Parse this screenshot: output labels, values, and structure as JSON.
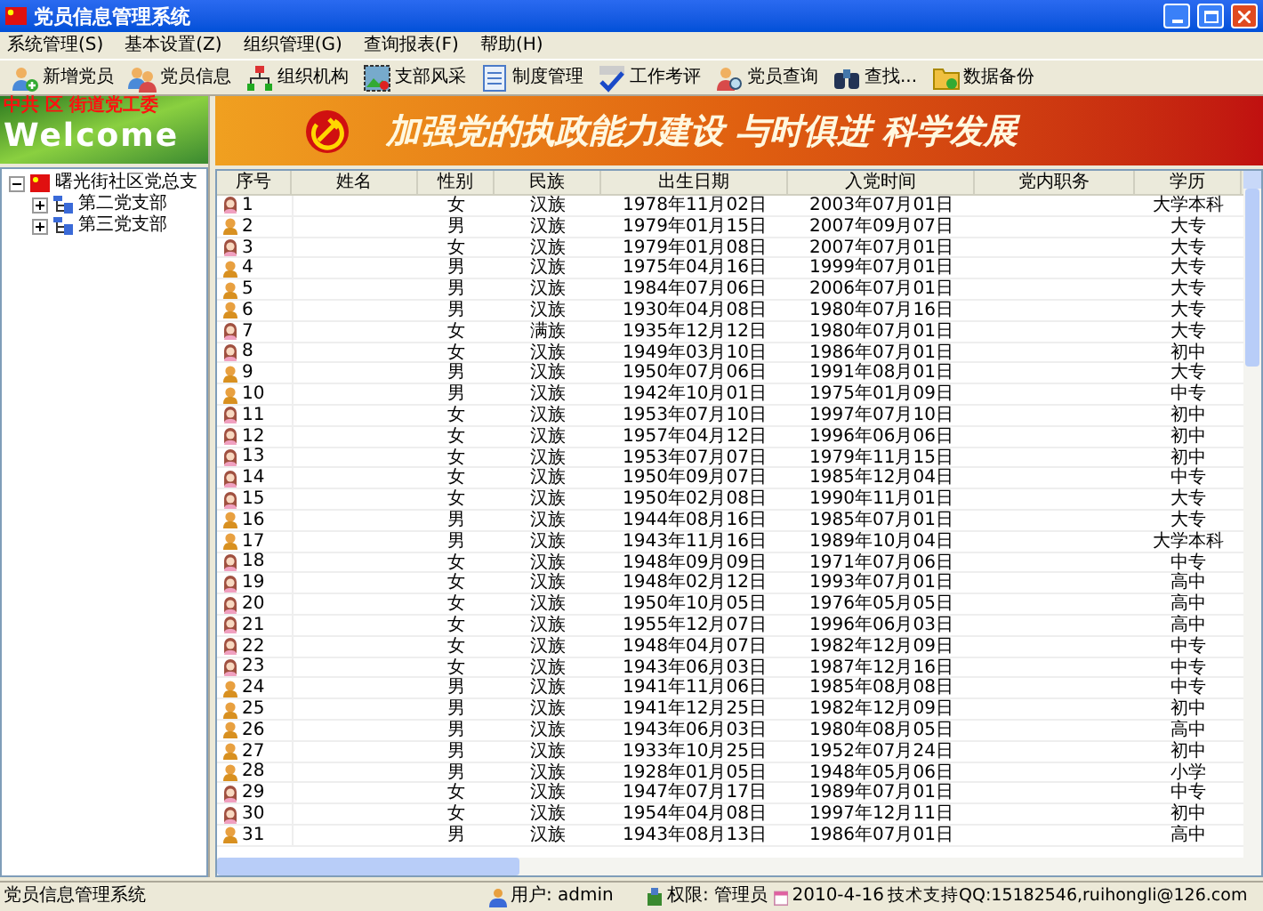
{
  "window": {
    "title": "党员信息管理系统"
  },
  "menu": [
    "系统管理(S)",
    "基本设置(Z)",
    "组织管理(G)",
    "查询报表(F)",
    "帮助(H)"
  ],
  "toolbar": [
    {
      "label": "新增党员",
      "kind": "person-add"
    },
    {
      "label": "党员信息",
      "kind": "people"
    },
    {
      "label": "组织机构",
      "kind": "org"
    },
    {
      "label": "支部风采",
      "kind": "picture"
    },
    {
      "label": "制度管理",
      "kind": "doc"
    },
    {
      "label": "工作考评",
      "kind": "abc"
    },
    {
      "label": "党员查询",
      "kind": "person-search"
    },
    {
      "label": "查找...",
      "kind": "binoculars"
    },
    {
      "label": "数据备份",
      "kind": "backup"
    }
  ],
  "welcome": {
    "heading": "中共 区 街道党工委",
    "text": "Welcome"
  },
  "banner": {
    "slogan": "加强党的执政能力建设 与时俱进 科学发展"
  },
  "tree": {
    "label": "曙光街社区党总支",
    "expanded": true,
    "children": [
      {
        "label": "第二党支部",
        "expanded": false
      },
      {
        "label": "第三党支部",
        "expanded": false
      }
    ]
  },
  "table": {
    "columns": [
      "序号",
      "姓名",
      "性别",
      "民族",
      "出生日期",
      "入党时间",
      "党内职务",
      "学历"
    ],
    "rows": [
      {
        "kind": "female",
        "no": "1",
        "sex": "女",
        "nation": "汉族",
        "birth": "1978年11月02日",
        "joined": "2003年07月01日",
        "edu": "大学本科"
      },
      {
        "kind": "male",
        "no": "2",
        "sex": "男",
        "nation": "汉族",
        "birth": "1979年01月15日",
        "joined": "2007年09月07日",
        "edu": "大专"
      },
      {
        "kind": "female",
        "no": "3",
        "sex": "女",
        "nation": "汉族",
        "birth": "1979年01月08日",
        "joined": "2007年07月01日",
        "edu": "大专"
      },
      {
        "kind": "male",
        "no": "4",
        "sex": "男",
        "nation": "汉族",
        "birth": "1975年04月16日",
        "joined": "1999年07月01日",
        "edu": "大专"
      },
      {
        "kind": "male",
        "no": "5",
        "sex": "男",
        "nation": "汉族",
        "birth": "1984年07月06日",
        "joined": "2006年07月01日",
        "edu": "大专"
      },
      {
        "kind": "male",
        "no": "6",
        "sex": "男",
        "nation": "汉族",
        "birth": "1930年04月08日",
        "joined": "1980年07月16日",
        "edu": "大专"
      },
      {
        "kind": "female",
        "no": "7",
        "sex": "女",
        "nation": "满族",
        "birth": "1935年12月12日",
        "joined": "1980年07月01日",
        "edu": "大专"
      },
      {
        "kind": "female",
        "no": "8",
        "sex": "女",
        "nation": "汉族",
        "birth": "1949年03月10日",
        "joined": "1986年07月01日",
        "edu": "初中"
      },
      {
        "kind": "male",
        "no": "9",
        "sex": "男",
        "nation": "汉族",
        "birth": "1950年07月06日",
        "joined": "1991年08月01日",
        "edu": "大专"
      },
      {
        "kind": "male",
        "no": "10",
        "sex": "男",
        "nation": "汉族",
        "birth": "1942年10月01日",
        "joined": "1975年01月09日",
        "edu": "中专"
      },
      {
        "kind": "female",
        "no": "11",
        "sex": "女",
        "nation": "汉族",
        "birth": "1953年07月10日",
        "joined": "1997年07月10日",
        "edu": "初中"
      },
      {
        "kind": "female",
        "no": "12",
        "sex": "女",
        "nation": "汉族",
        "birth": "1957年04月12日",
        "joined": "1996年06月06日",
        "edu": "初中"
      },
      {
        "kind": "female",
        "no": "13",
        "sex": "女",
        "nation": "汉族",
        "birth": "1953年07月07日",
        "joined": "1979年11月15日",
        "edu": "初中"
      },
      {
        "kind": "female",
        "no": "14",
        "sex": "女",
        "nation": "汉族",
        "birth": "1950年09月07日",
        "joined": "1985年12月04日",
        "edu": "中专"
      },
      {
        "kind": "female",
        "no": "15",
        "sex": "女",
        "nation": "汉族",
        "birth": "1950年02月08日",
        "joined": "1990年11月01日",
        "edu": "大专"
      },
      {
        "kind": "male",
        "no": "16",
        "sex": "男",
        "nation": "汉族",
        "birth": "1944年08月16日",
        "joined": "1985年07月01日",
        "edu": "大专"
      },
      {
        "kind": "male",
        "no": "17",
        "sex": "男",
        "nation": "汉族",
        "birth": "1943年11月16日",
        "joined": "1989年10月04日",
        "edu": "大学本科"
      },
      {
        "kind": "female",
        "no": "18",
        "sex": "女",
        "nation": "汉族",
        "birth": "1948年09月09日",
        "joined": "1971年07月06日",
        "edu": "中专"
      },
      {
        "kind": "female",
        "no": "19",
        "sex": "女",
        "nation": "汉族",
        "birth": "1948年02月12日",
        "joined": "1993年07月01日",
        "edu": "高中"
      },
      {
        "kind": "female",
        "no": "20",
        "sex": "女",
        "nation": "汉族",
        "birth": "1950年10月05日",
        "joined": "1976年05月05日",
        "edu": "高中"
      },
      {
        "kind": "female",
        "no": "21",
        "sex": "女",
        "nation": "汉族",
        "birth": "1955年12月07日",
        "joined": "1996年06月03日",
        "edu": "高中"
      },
      {
        "kind": "female",
        "no": "22",
        "sex": "女",
        "nation": "汉族",
        "birth": "1948年04月07日",
        "joined": "1982年12月09日",
        "edu": "中专"
      },
      {
        "kind": "female",
        "no": "23",
        "sex": "女",
        "nation": "汉族",
        "birth": "1943年06月03日",
        "joined": "1987年12月16日",
        "edu": "中专"
      },
      {
        "kind": "male",
        "no": "24",
        "sex": "男",
        "nation": "汉族",
        "birth": "1941年11月06日",
        "joined": "1985年08月08日",
        "edu": "中专"
      },
      {
        "kind": "male",
        "no": "25",
        "sex": "男",
        "nation": "汉族",
        "birth": "1941年12月25日",
        "joined": "1982年12月09日",
        "edu": "初中"
      },
      {
        "kind": "male",
        "no": "26",
        "sex": "男",
        "nation": "汉族",
        "birth": "1943年06月03日",
        "joined": "1980年08月05日",
        "edu": "高中"
      },
      {
        "kind": "male",
        "no": "27",
        "sex": "男",
        "nation": "汉族",
        "birth": "1933年10月25日",
        "joined": "1952年07月24日",
        "edu": "初中"
      },
      {
        "kind": "male",
        "no": "28",
        "sex": "男",
        "nation": "汉族",
        "birth": "1928年01月05日",
        "joined": "1948年05月06日",
        "edu": "小学"
      },
      {
        "kind": "female",
        "no": "29",
        "sex": "女",
        "nation": "汉族",
        "birth": "1947年07月17日",
        "joined": "1989年07月01日",
        "edu": "中专"
      },
      {
        "kind": "female",
        "no": "30",
        "sex": "女",
        "nation": "汉族",
        "birth": "1954年04月08日",
        "joined": "1997年12月11日",
        "edu": "初中"
      },
      {
        "kind": "male",
        "no": "31",
        "sex": "男",
        "nation": "汉族",
        "birth": "1943年08月13日",
        "joined": "1986年07月01日",
        "edu": "高中"
      }
    ]
  },
  "status_bar": {
    "app": "党员信息管理系统",
    "user": "用户: admin",
    "role": "权限: 管理员",
    "date": "2010-4-16",
    "support": "技术支持QQ:15182546,ruihongli@126.com"
  }
}
